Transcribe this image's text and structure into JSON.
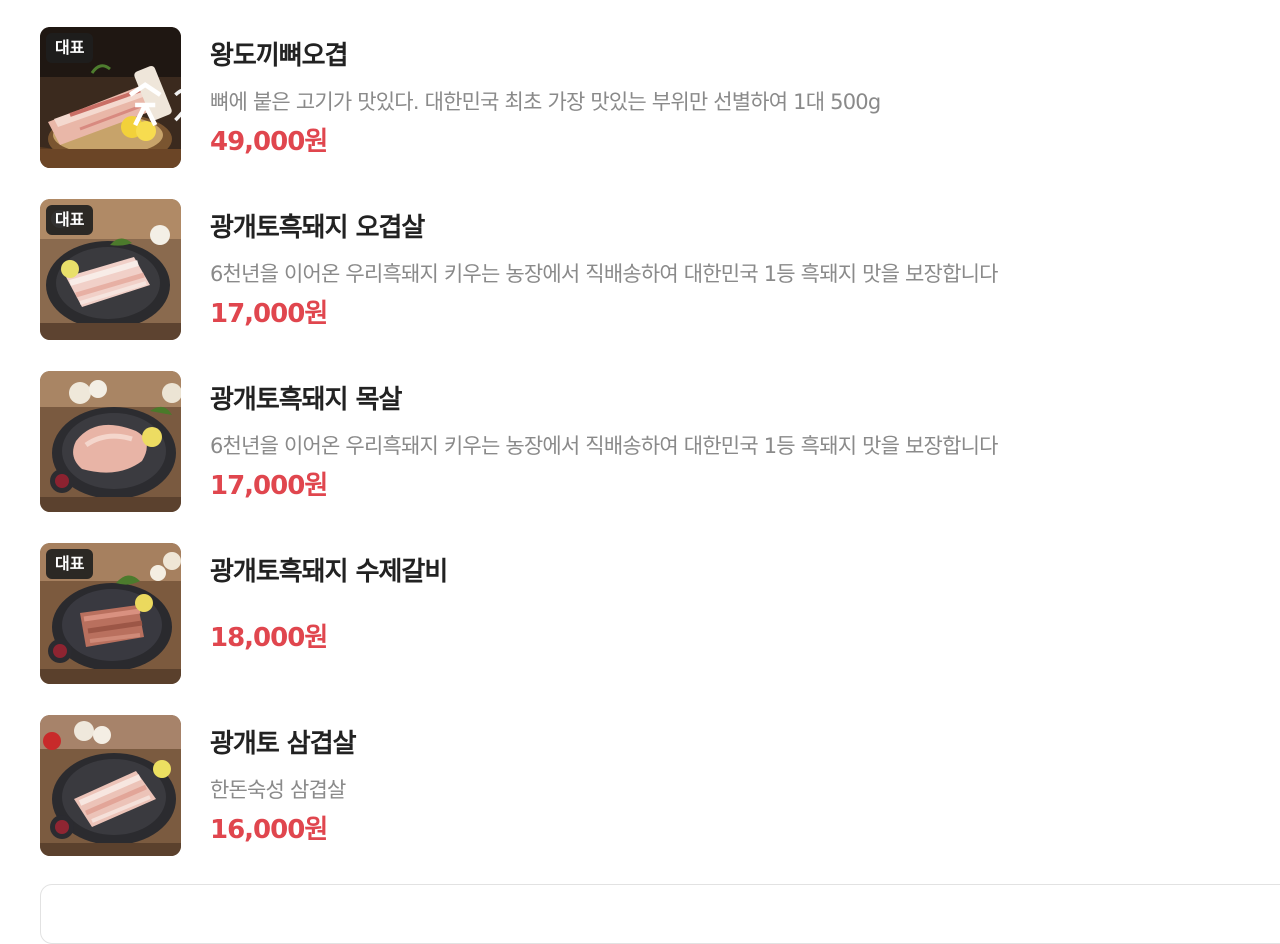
{
  "menu": {
    "items": [
      {
        "badge": "대표",
        "logo_text": "흑돈생",
        "name": "왕도끼뼈오겹",
        "description": "뼈에 붙은 고기가 맛있다. 대한민국 최초 가장 맛있는 부위만 선별하여 1대 500g",
        "price": "49,000원"
      },
      {
        "badge": "대표",
        "name": "광개토흑돼지 오겹살",
        "description": "6천년을 이어온 우리흑돼지 키우는 농장에서 직배송하여 대한민국 1등 흑돼지 맛을 보장합니다",
        "price": "17,000원"
      },
      {
        "name": "광개토흑돼지 목살",
        "description": "6천년을 이어온 우리흑돼지 키우는 농장에서 직배송하여 대한민국 1등 흑돼지 맛을 보장합니다",
        "price": "17,000원"
      },
      {
        "badge": "대표",
        "name": "광개토흑돼지 수제갈비",
        "price": "18,000원"
      },
      {
        "name": "광개토 삼겹살",
        "description": "한돈숙성 삼겹살",
        "price": "16,000원"
      }
    ]
  },
  "colors": {
    "price": "#e0464e",
    "name": "#222222",
    "description": "#8a8a8a",
    "badge_bg": "#1e1e1e"
  }
}
